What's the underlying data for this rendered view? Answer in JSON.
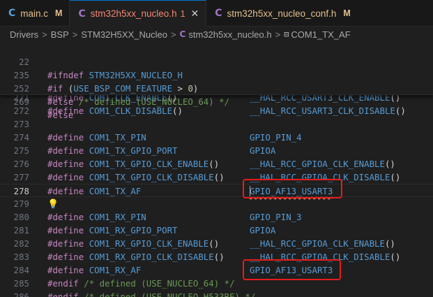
{
  "tabs": [
    {
      "icon": "C",
      "label": "main.c",
      "badge": "M",
      "state": "modified"
    },
    {
      "icon": "C",
      "label": "stm32h5xx_nucleo.h",
      "badge": "1",
      "state": "error",
      "active": true,
      "close": "✕"
    },
    {
      "icon": "C",
      "label": "stm32h5xx_nucleo_conf.h",
      "badge": "M",
      "state": "modified"
    }
  ],
  "breadcrumb": {
    "items": [
      "Drivers",
      "BSP",
      "STM32H5XX_Nucleo"
    ],
    "file_icon": "C",
    "file": "stm32h5xx_nucleo.h",
    "symbol_icon": "⊟",
    "symbol": "COM1_TX_AF",
    "separator": ">"
  },
  "sticky_lines": [
    {
      "n": "22",
      "directive": "#ifndef",
      "rest": " STM32H5XX_NUCLEO_H"
    },
    {
      "n": "235",
      "directive": "#if",
      "open": " (",
      "macro": "USE_BSP_COM_FEATURE",
      "op": " > ",
      "num": "0",
      "close": ")"
    },
    {
      "n": "252",
      "directive": "#else",
      "comment": " /* defined (USE_NUCLEO_64) */"
    },
    {
      "n": "269",
      "directive": "#else"
    }
  ],
  "code_lines": [
    {
      "n": "271",
      "define": "#define",
      "name": "COM1_CLK_ENABLE",
      "paren": "()",
      "value": "__HAL_RCC_USART3_CLK_ENABLE",
      "vparen": "()"
    },
    {
      "n": "272",
      "define": "#define",
      "name": "COM1_CLK_DISABLE",
      "paren": "()",
      "value": "__HAL_RCC_USART3_CLK_DISABLE",
      "vparen": "()"
    },
    {
      "n": "273"
    },
    {
      "n": "274",
      "define": "#define",
      "name": "COM1_TX_PIN",
      "value": "GPIO_PIN_4"
    },
    {
      "n": "275",
      "define": "#define",
      "name": "COM1_TX_GPIO_PORT",
      "value": "GPIOA"
    },
    {
      "n": "276",
      "define": "#define",
      "name": "COM1_TX_GPIO_CLK_ENABLE",
      "paren": "()",
      "value": "__HAL_RCC_GPIOA_CLK_ENABLE",
      "vparen": "()"
    },
    {
      "n": "277",
      "define": "#define",
      "name": "COM1_TX_GPIO_CLK_DISABLE",
      "paren": "()",
      "value": "__HAL_RCC_GPIOA_CLK_DISABLE",
      "vparen": "()"
    },
    {
      "n": "278",
      "define": "#define",
      "name": "COM1_TX_AF",
      "value": "GPIO_AF13_USART3",
      "current": true
    },
    {
      "n": "279",
      "bulb": "💡"
    },
    {
      "n": "280",
      "define": "#define",
      "name": "COM1_RX_PIN",
      "value": "GPIO_PIN_3"
    },
    {
      "n": "281",
      "define": "#define",
      "name": "COM1_RX_GPIO_PORT",
      "value": "GPIOA"
    },
    {
      "n": "282",
      "define": "#define",
      "name": "COM1_RX_GPIO_CLK_ENABLE",
      "paren": "()",
      "value": "__HAL_RCC_GPIOA_CLK_ENABLE",
      "vparen": "()"
    },
    {
      "n": "283",
      "define": "#define",
      "name": "COM1_RX_GPIO_CLK_DISABLE",
      "paren": "()",
      "value": "__HAL_RCC_GPIOA_CLK_DISABLE",
      "vparen": "()"
    },
    {
      "n": "284",
      "define": "#define",
      "name": "COM1_RX_AF",
      "value": "GPIO_AF13_USART3"
    },
    {
      "n": "285",
      "endif": "#endif",
      "comment": " /* defined (USE_NUCLEO_64) */"
    },
    {
      "n": "286",
      "endif": "#endif",
      "comment": " /* defined (USE_NUCLEO_H533RE) */"
    }
  ],
  "colors": {
    "accent": "#0078d4",
    "highlight_box": "#e51c1c",
    "modified": "#e2c08d",
    "error": "#f48771"
  }
}
